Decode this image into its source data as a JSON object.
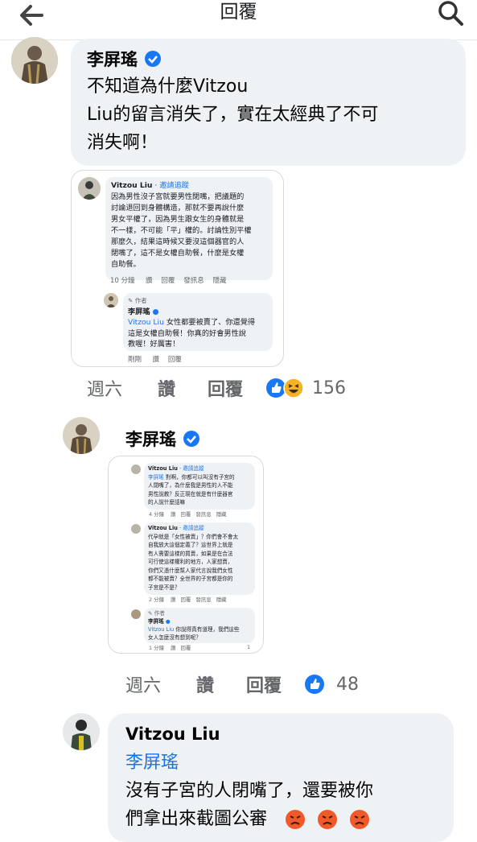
{
  "header": {
    "title": "回覆"
  },
  "comment1": {
    "author": "李屏瑤",
    "text_lines": [
      "不知道為什麼Vitzou",
      "Liu的留言消失了，實在太經典了不可",
      "消失啊！"
    ],
    "screenshot": {
      "c1_name": "Vitzou Liu",
      "c1_invite": "邀請追蹤",
      "c1_lines": [
        "因為男性沒子宮就要男性閉嘴，把議題的",
        "討論退回到身體構造，那就不要再說什麼",
        "男女平權了，因為男生跟女生的身體就是",
        "不一樣，不可能「平」權的。討論性別平權",
        "那麼久，結果這時候又要沒這個器官的人",
        "閉嘴了，這不是女權自助餐，什麼是女權",
        "自助餐。"
      ],
      "c1_meta": [
        "10 分鐘",
        "讚",
        "回覆",
        "發訊息",
        "隱藏"
      ],
      "c2_badge": "作者",
      "c2_name": "李屏瑤",
      "c2_mention": "Vitzou Liu",
      "c2_lines": [
        "女性都要被賣了、你還覺得",
        "這是女權自助餐！你真的好會男性說",
        "教喔！好厲害！"
      ],
      "c2_meta": [
        "剛剛",
        "讚",
        "回覆"
      ]
    },
    "actions": {
      "time": "週六",
      "like": "讚",
      "reply": "回覆",
      "reactions": [
        "like-reaction",
        "laugh-reaction"
      ],
      "count": "156"
    }
  },
  "comment2": {
    "author": "李屏瑤",
    "screenshot": {
      "a_name": "Vitzou Liu",
      "a_invite": "邀請追蹤",
      "a_mention": "李屏瑤",
      "a_lines": [
        "對啊，你都可以叫沒有子宮的",
        "人閉嘴了，為什麼我是男性的人不能",
        "男性說教？反正現在就是有什麼器官",
        "的人說什麼話嘛"
      ],
      "a_meta": [
        "4 分鐘",
        "讚",
        "回覆",
        "發訊息",
        "隱藏"
      ],
      "b_name": "Vitzou Liu",
      "b_invite": "邀請追蹤",
      "b_lines": [
        "代孕就是「女性被賣」？你們會不會太",
        "自我放大這個定義了？這世界上就是",
        "有人需要這樣的買賣，如果是在合法",
        "可行使這樣權利的地方，人家想賣，",
        "你們又憑什麼幫人家代言說我們女性",
        "都不能被賣？全世界的子宮都是你的",
        "子宮是不是？"
      ],
      "b_meta": [
        "2 分鐘",
        "讚",
        "回覆",
        "發訊息",
        "隱藏"
      ],
      "c_badge": "作者",
      "c_name": "李屏瑤",
      "c_mention": "Vitzou Liu",
      "c_lines": [
        "你說得真有道理，我們這些",
        "女人怎麼沒有想到呢？"
      ],
      "c_meta": [
        "1 分鐘",
        "讚",
        "回覆"
      ],
      "c_count": "1"
    },
    "actions": {
      "time": "週六",
      "like": "讚",
      "reply": "回覆",
      "reactions": [
        "like-reaction"
      ],
      "count": "48"
    }
  },
  "comment3": {
    "author": "Vitzou Liu",
    "mention": "李屏瑤",
    "text_lines": [
      "沒有子宮的人閉嘴了，還要被你",
      "們拿出來截圖公審"
    ],
    "emojis": [
      "angry-emoji",
      "angry-emoji",
      "angry-emoji"
    ]
  },
  "colors": {
    "link": "#1b74e4",
    "bubble": "#eff2f5",
    "meta": "#65676b",
    "like_blue": "#1877f2",
    "verified": "#1877f2"
  }
}
